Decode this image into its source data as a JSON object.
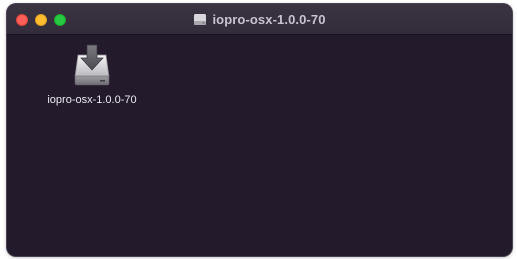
{
  "window": {
    "title": "iopro-osx-1.0.0-70",
    "title_icon": "disk-image-icon",
    "traffic_lights": {
      "close": "#fe5f57",
      "minimize": "#febc2e",
      "maximize": "#28c840"
    }
  },
  "content": {
    "items": [
      {
        "label": "iopro-osx-1.0.0-70",
        "icon": "installer-disk-icon"
      }
    ]
  },
  "colors": {
    "background": "#231b2c",
    "titlebar": "#332c3b"
  }
}
